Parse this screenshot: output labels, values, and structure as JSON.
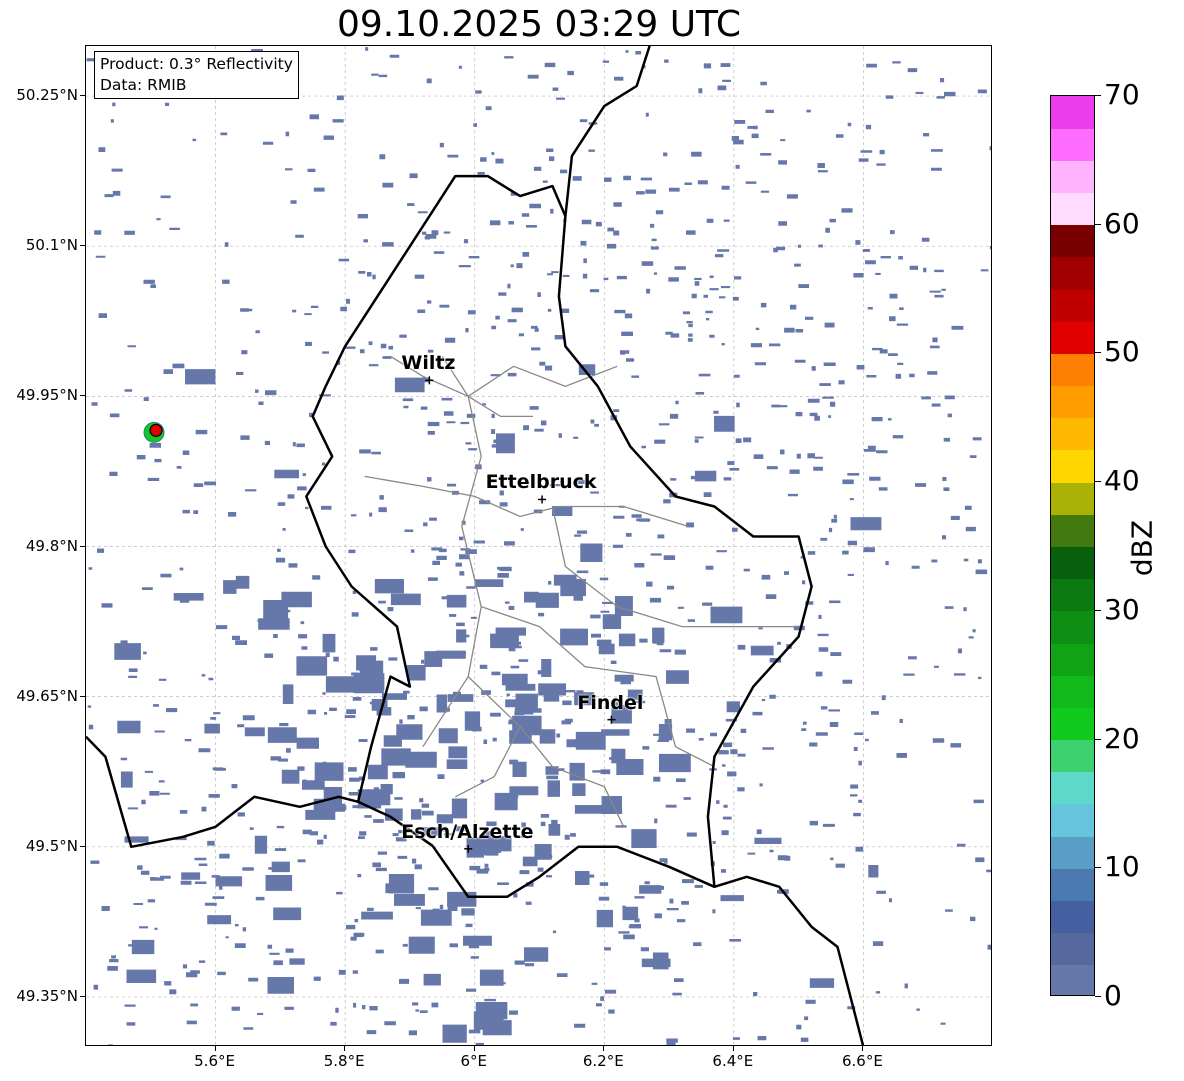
{
  "title": "09.10.2025 03:29 UTC",
  "info_box": {
    "product": "Product: 0.3° Reflectivity",
    "data_source": "Data: RMIB"
  },
  "map": {
    "extent": {
      "lon_min": 5.4,
      "lon_max": 6.8,
      "lat_min": 49.3,
      "lat_max": 50.3
    },
    "lat_ticks": [
      {
        "value": 50.25,
        "label": "50.25°N"
      },
      {
        "value": 50.1,
        "label": "50.1°N"
      },
      {
        "value": 49.95,
        "label": "49.95°N"
      },
      {
        "value": 49.8,
        "label": "49.8°N"
      },
      {
        "value": 49.65,
        "label": "49.65°N"
      },
      {
        "value": 49.5,
        "label": "49.5°N"
      },
      {
        "value": 49.35,
        "label": "49.35°N"
      }
    ],
    "lon_ticks": [
      {
        "value": 5.6,
        "label": "5.6°E"
      },
      {
        "value": 5.8,
        "label": "5.8°E"
      },
      {
        "value": 6.0,
        "label": "6°E"
      },
      {
        "value": 6.2,
        "label": "6.2°E"
      },
      {
        "value": 6.4,
        "label": "6.4°E"
      },
      {
        "value": 6.6,
        "label": "6.6°E"
      }
    ],
    "cities": [
      {
        "name": "Wiltz",
        "lon": 5.93,
        "lat": 49.966
      },
      {
        "name": "Ettelbruck",
        "lon": 6.104,
        "lat": 49.847
      },
      {
        "name": "Findel",
        "lon": 6.211,
        "lat": 49.627
      },
      {
        "name": "Esch/Alzette",
        "lon": 5.99,
        "lat": 49.498
      }
    ],
    "radar_site": {
      "lon": 5.505,
      "lat": 49.914
    },
    "echo_color": "#6677aa",
    "border_color": "#000000",
    "canton_color": "#888888"
  },
  "colorbar": {
    "unit": "dBZ",
    "min": 0,
    "max": 70,
    "tick_labels": [
      "0",
      "10",
      "20",
      "30",
      "40",
      "50",
      "60",
      "70"
    ],
    "colors": [
      "#6677aa",
      "#55699f",
      "#4460a0",
      "#4a7ab0",
      "#5a9ec8",
      "#66c4dc",
      "#5ed8c8",
      "#3ed26e",
      "#12c91e",
      "#11b91a",
      "#10a316",
      "#0f8e14",
      "#0c7a10",
      "#07610c",
      "#437a10",
      "#aab205",
      "#ffd700",
      "#ffb800",
      "#ff9c00",
      "#ff7f00",
      "#e00000",
      "#c00000",
      "#a00000",
      "#780000",
      "#ffdcff",
      "#ffb4ff",
      "#ff6cff",
      "#ec3cec"
    ]
  }
}
